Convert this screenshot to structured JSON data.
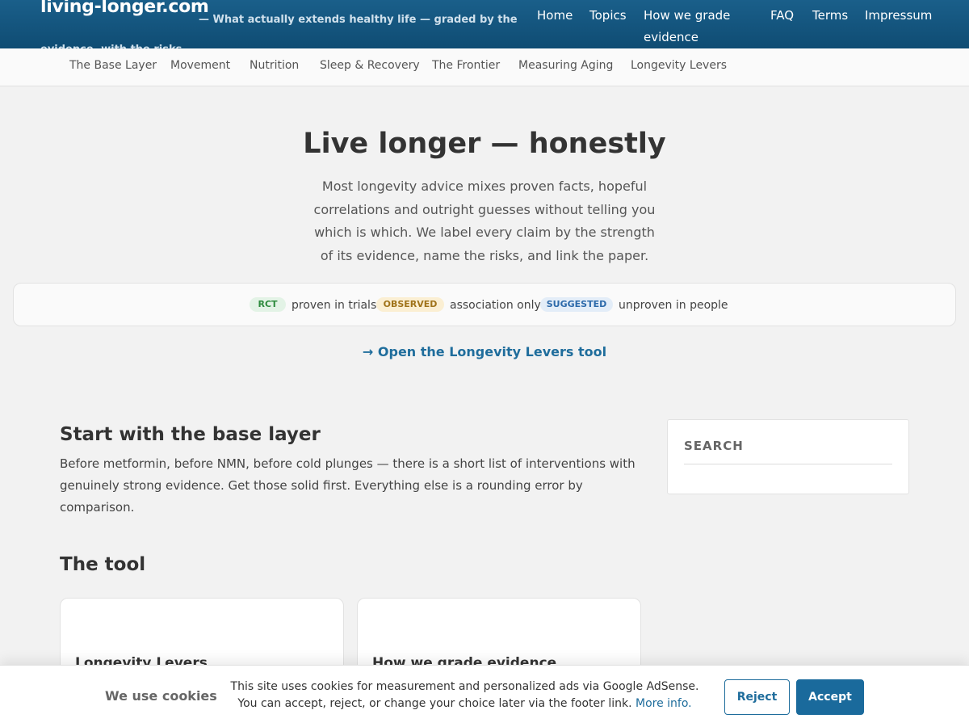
{
  "header": {
    "site_title": "living-longer.com",
    "tagline": "— What actually extends healthy life — graded by the evidence, with the risks",
    "nav": {
      "home": "Home",
      "topics": "Topics",
      "grade": "How we grade evidence",
      "faq": "FAQ",
      "terms": "Terms",
      "impressum": "Impressum"
    }
  },
  "categories": [
    "The Base Layer",
    "Movement",
    "Nutrition",
    "Sleep & Recovery",
    "The Frontier",
    "Measuring Aging",
    "Longevity Levers"
  ],
  "hero": {
    "title": "Live longer — honestly",
    "text": "Most longevity advice mixes proven facts, hopeful correlations and outright guesses without telling you which is which. We label every claim by the strength of its evidence, name the risks, and link the paper.",
    "legend": {
      "rct_badge": "RCT",
      "rct_label": "proven in trials",
      "observed_badge": "OBSERVED",
      "observed_label": "association only",
      "suggested_badge": "SUGGESTED",
      "suggested_label": "unproven in people"
    },
    "cta": "→ Open the Longevity Levers tool"
  },
  "main": {
    "base_heading": "Start with the base layer",
    "base_text": "Before metformin, before NMN, before cold plunges — there is a short list of interventions with genuinely strong evidence. Get those solid first. Everything else is a rounding error by comparison.",
    "tool_heading": "The tool",
    "cards": [
      "Longevity Levers",
      "How we grade evidence"
    ]
  },
  "sidebar": {
    "search_label": "SEARCH"
  },
  "cookie": {
    "title": "We use cookies",
    "text": "This site uses cookies for measurement and personalized ads via Google AdSense. You can accept, reject, or change your choice later via the footer link.",
    "link": "More info.",
    "reject": "Reject",
    "accept": "Accept"
  },
  "colors": {
    "header_bg": "#0f4c73",
    "accent": "#1f6d9c",
    "rct_green": "#2e8b3e",
    "observed_amber": "#a0731a",
    "suggested_blue": "#2d6aaa"
  }
}
